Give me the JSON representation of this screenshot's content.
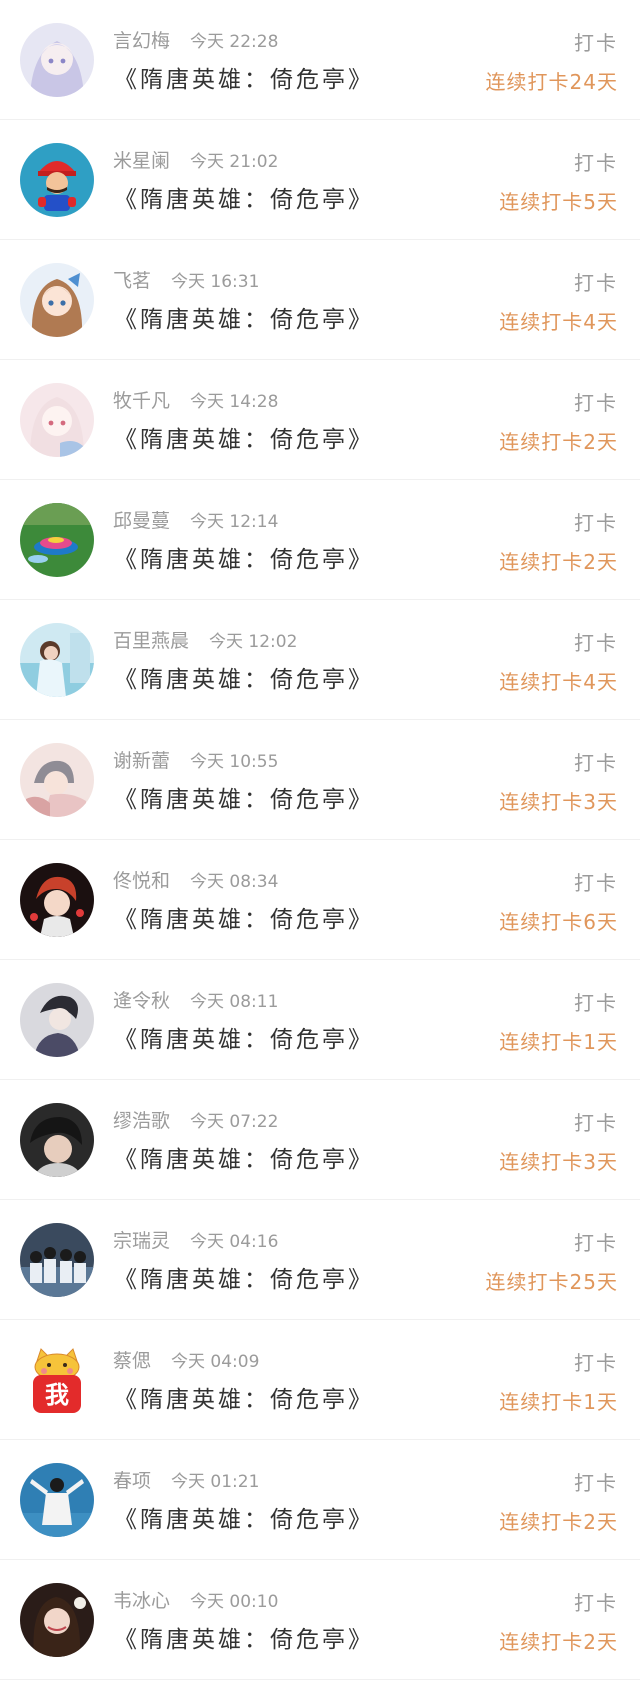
{
  "accent_color": "#e0965b",
  "entries": [
    {
      "name": "言幻梅",
      "time": "今天 22:28",
      "title": "《隋唐英雄：倚危亭》",
      "action": "打卡",
      "streak": "连续打卡24天",
      "avatar": "anime-girl-avatar"
    },
    {
      "name": "米星阑",
      "time": "今天 21:02",
      "title": "《隋唐英雄：倚危亭》",
      "action": "打卡",
      "streak": "连续打卡5天",
      "avatar": "mario-avatar"
    },
    {
      "name": "飞茗",
      "time": "今天 16:31",
      "title": "《隋唐英雄：倚危亭》",
      "action": "打卡",
      "streak": "连续打卡4天",
      "avatar": "anime-girl-avatar"
    },
    {
      "name": "牧千凡",
      "time": "今天 14:28",
      "title": "《隋唐英雄：倚危亭》",
      "action": "打卡",
      "streak": "连续打卡2天",
      "avatar": "anime-girl-avatar"
    },
    {
      "name": "邱曼蔓",
      "time": "今天 12:14",
      "title": "《隋唐英雄：倚危亭》",
      "action": "打卡",
      "streak": "连续打卡2天",
      "avatar": "spinning-top-avatar"
    },
    {
      "name": "百里燕晨",
      "time": "今天 12:02",
      "title": "《隋唐英雄：倚危亭》",
      "action": "打卡",
      "streak": "连续打卡4天",
      "avatar": "girl-photo-avatar"
    },
    {
      "name": "谢新蕾",
      "time": "今天 10:55",
      "title": "《隋唐英雄：倚危亭》",
      "action": "打卡",
      "streak": "连续打卡3天",
      "avatar": "anime-couple-avatar"
    },
    {
      "name": "佟悦和",
      "time": "今天 08:34",
      "title": "《隋唐英雄：倚危亭》",
      "action": "打卡",
      "streak": "连续打卡6天",
      "avatar": "anime-boy-avatar"
    },
    {
      "name": "逄令秋",
      "time": "今天 08:11",
      "title": "《隋唐英雄：倚危亭》",
      "action": "打卡",
      "streak": "连续打卡1天",
      "avatar": "anime-boy-avatar"
    },
    {
      "name": "缪浩歌",
      "time": "今天 07:22",
      "title": "《隋唐英雄：倚危亭》",
      "action": "打卡",
      "streak": "连续打卡3天",
      "avatar": "boy-photo-avatar"
    },
    {
      "name": "宗瑞灵",
      "time": "今天 04:16",
      "title": "《隋唐英雄：倚危亭》",
      "action": "打卡",
      "streak": "连续打卡25天",
      "avatar": "group-photo-avatar"
    },
    {
      "name": "蔡偲",
      "time": "今天 04:09",
      "title": "《隋唐英雄：倚危亭》",
      "action": "打卡",
      "streak": "连续打卡1天",
      "avatar": "cat-wo-sticker-avatar",
      "sticker_text": "我"
    },
    {
      "name": "春项",
      "time": "今天 01:21",
      "title": "《隋唐英雄：倚危亭》",
      "action": "打卡",
      "streak": "连续打卡2天",
      "avatar": "figure-photo-avatar"
    },
    {
      "name": "韦冰心",
      "time": "今天 00:10",
      "title": "《隋唐英雄：倚危亭》",
      "action": "打卡",
      "streak": "连续打卡2天",
      "avatar": "woman-photo-avatar"
    }
  ]
}
